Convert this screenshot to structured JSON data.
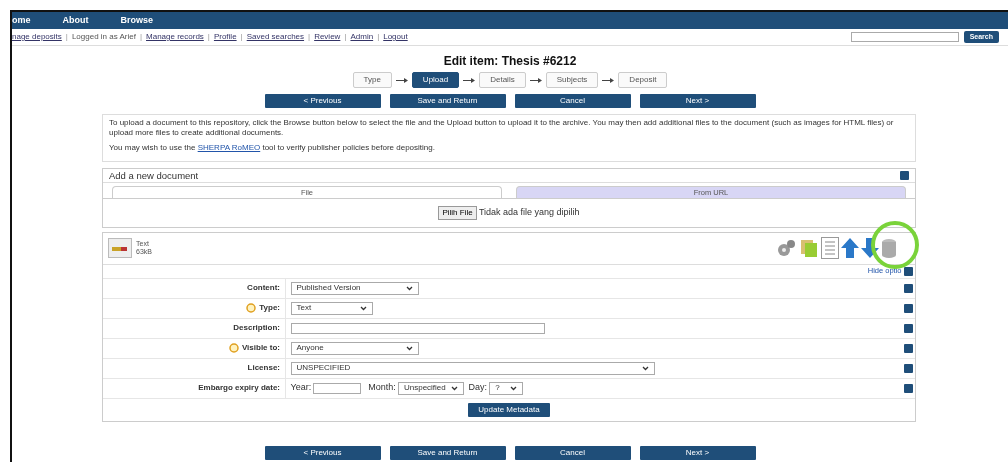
{
  "menu": [
    "ome",
    "About",
    "Browse"
  ],
  "user_links": [
    {
      "text": "nage deposits",
      "kind": "link"
    },
    {
      "text": "Logged in as Arief",
      "kind": "text"
    },
    {
      "text": "Manage records",
      "kind": "link"
    },
    {
      "text": "Profile",
      "kind": "link"
    },
    {
      "text": "Saved searches",
      "kind": "link"
    },
    {
      "text": "Review",
      "kind": "link"
    },
    {
      "text": "Admin",
      "kind": "link"
    },
    {
      "text": "Logout",
      "kind": "link"
    }
  ],
  "link_separator": "|",
  "search": {
    "button": "Search"
  },
  "title": "Edit item: Thesis #6212",
  "steps": [
    {
      "label": "Type",
      "selected": false
    },
    {
      "label": "Upload",
      "selected": true
    },
    {
      "label": "Details",
      "selected": false
    },
    {
      "label": "Subjects",
      "selected": false
    },
    {
      "label": "Deposit",
      "selected": false
    }
  ],
  "buttons_top": [
    "< Previous",
    "Save and Return",
    "Cancel",
    "Next >"
  ],
  "intro": {
    "text": "To upload a document to this repository, click the Browse button below to select the file and the Upload button to upload it to the archive. You may then add additional files to the document (such as images for HTML files) or upload more files to create additional documents.",
    "before": "You may wish to use the ",
    "link": "SHERPA RoMEO",
    "after": " tool to verify publisher policies before depositing."
  },
  "panel": {
    "title": "Add a new document",
    "tabs": [
      {
        "label": "File",
        "selected": true
      },
      {
        "label": "From URL",
        "selected": false
      }
    ],
    "file_button": "Pilih File",
    "file_status": "Tidak ada file yang dipilih"
  },
  "document": {
    "type": "Text",
    "size": "63kB",
    "hide_options": "Hide optio"
  },
  "fields": [
    {
      "kind": "select",
      "label": "Content:",
      "required": false,
      "value": "Published Version"
    },
    {
      "kind": "select",
      "label": "Type:",
      "required": true,
      "value": "Text"
    },
    {
      "kind": "input",
      "label": "Description:",
      "required": false
    },
    {
      "kind": "select",
      "label": "Visible to:",
      "required": true,
      "value": "Anyone"
    },
    {
      "kind": "select",
      "label": "License:",
      "required": false,
      "value": "UNSPECIFIED"
    },
    {
      "kind": "embargo",
      "label": "Embargo expiry date:",
      "required": false,
      "year_label": "Year:",
      "month_label": "Month:",
      "month_value": "Unspecified",
      "day_label": "Day:",
      "day_value": "?"
    }
  ],
  "update_button": "Update Metadata",
  "buttons_bottom": [
    "< Previous",
    "Save and Return",
    "Cancel",
    "Next >"
  ]
}
